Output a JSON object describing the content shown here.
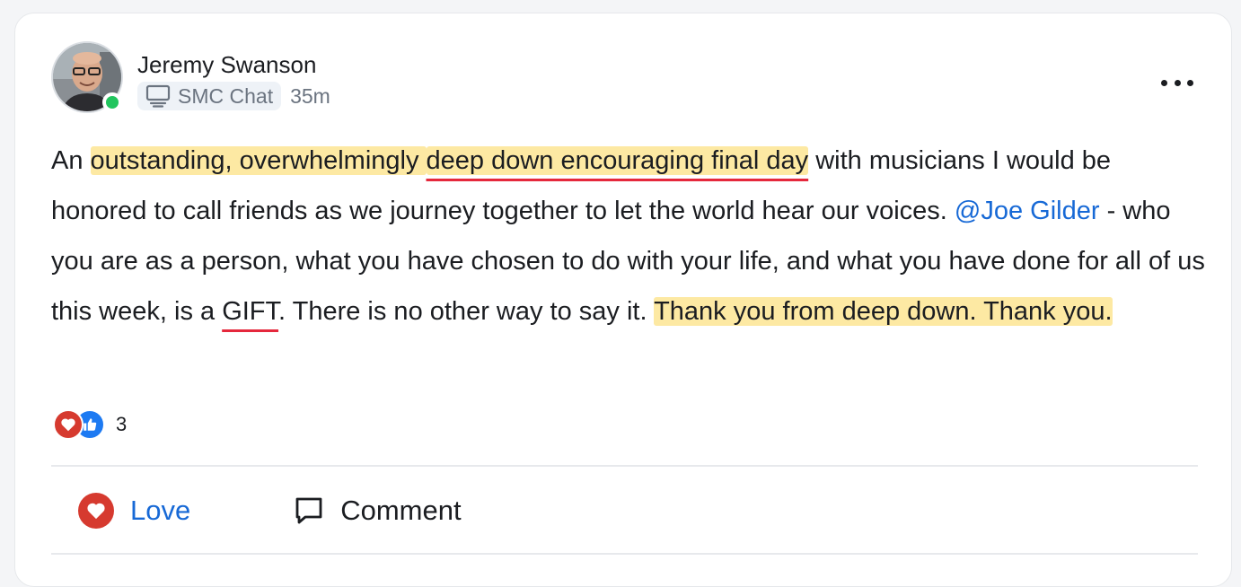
{
  "post": {
    "author": "Jeremy Swanson",
    "space": "SMC Chat",
    "time": "35m",
    "body": {
      "t1": "An ",
      "hl1": "outstanding, overwhelmingly ",
      "hl2": "deep down encouraging final day",
      "t2": " with musicians I would be honored to call friends as we journey together to let the world hear our voices. ",
      "mention": "@Joe Gilder",
      "t3": " - who you are as a person, what you have chosen to do with your life, and what you have done for all of us this week, is a ",
      "gift": "GIFT",
      "t4": ". There is no other way to say it. ",
      "hl3": "Thank you from deep down. Thank you."
    },
    "reaction_count": "3"
  },
  "actions": {
    "love_label": "Love",
    "comment_label": "Comment"
  },
  "icons": {
    "space": "monitor-icon",
    "more": "more-horizontal-icon",
    "love": "heart-icon",
    "like": "thumbs-up-icon",
    "comment": "speech-bubble-icon"
  },
  "colors": {
    "accent": "#1769d6",
    "love": "#d63a2f",
    "like": "#1d7af2",
    "highlight": "#fde9a3",
    "underline": "#e5283c",
    "presence": "#22c55e"
  }
}
